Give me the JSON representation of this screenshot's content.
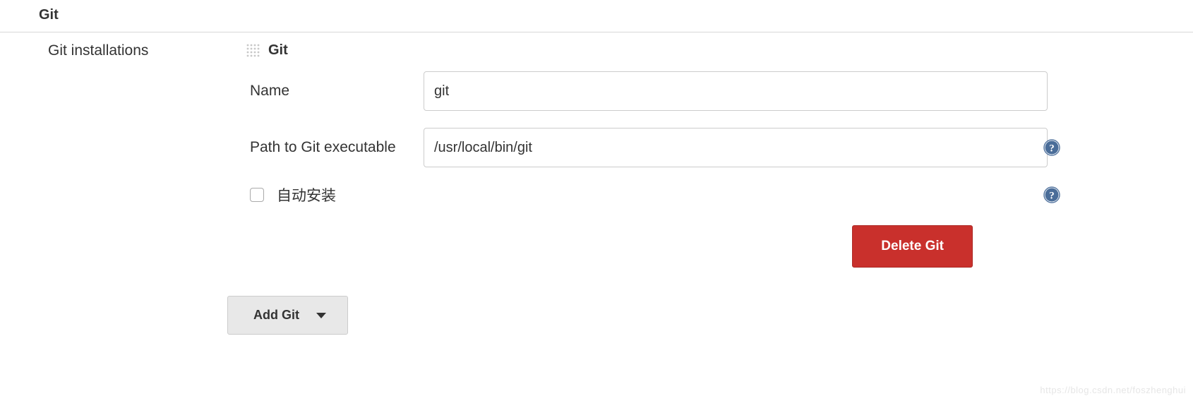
{
  "section": {
    "title": "Git",
    "installations_label": "Git installations"
  },
  "tool": {
    "title": "Git",
    "name_label": "Name",
    "name_value": "git",
    "path_label": "Path to Git executable",
    "path_value": "/usr/local/bin/git",
    "auto_install_label": "自动安装"
  },
  "buttons": {
    "delete": "Delete Git",
    "add": "Add Git"
  },
  "watermark": "https://blog.csdn.net/foszhenghui"
}
